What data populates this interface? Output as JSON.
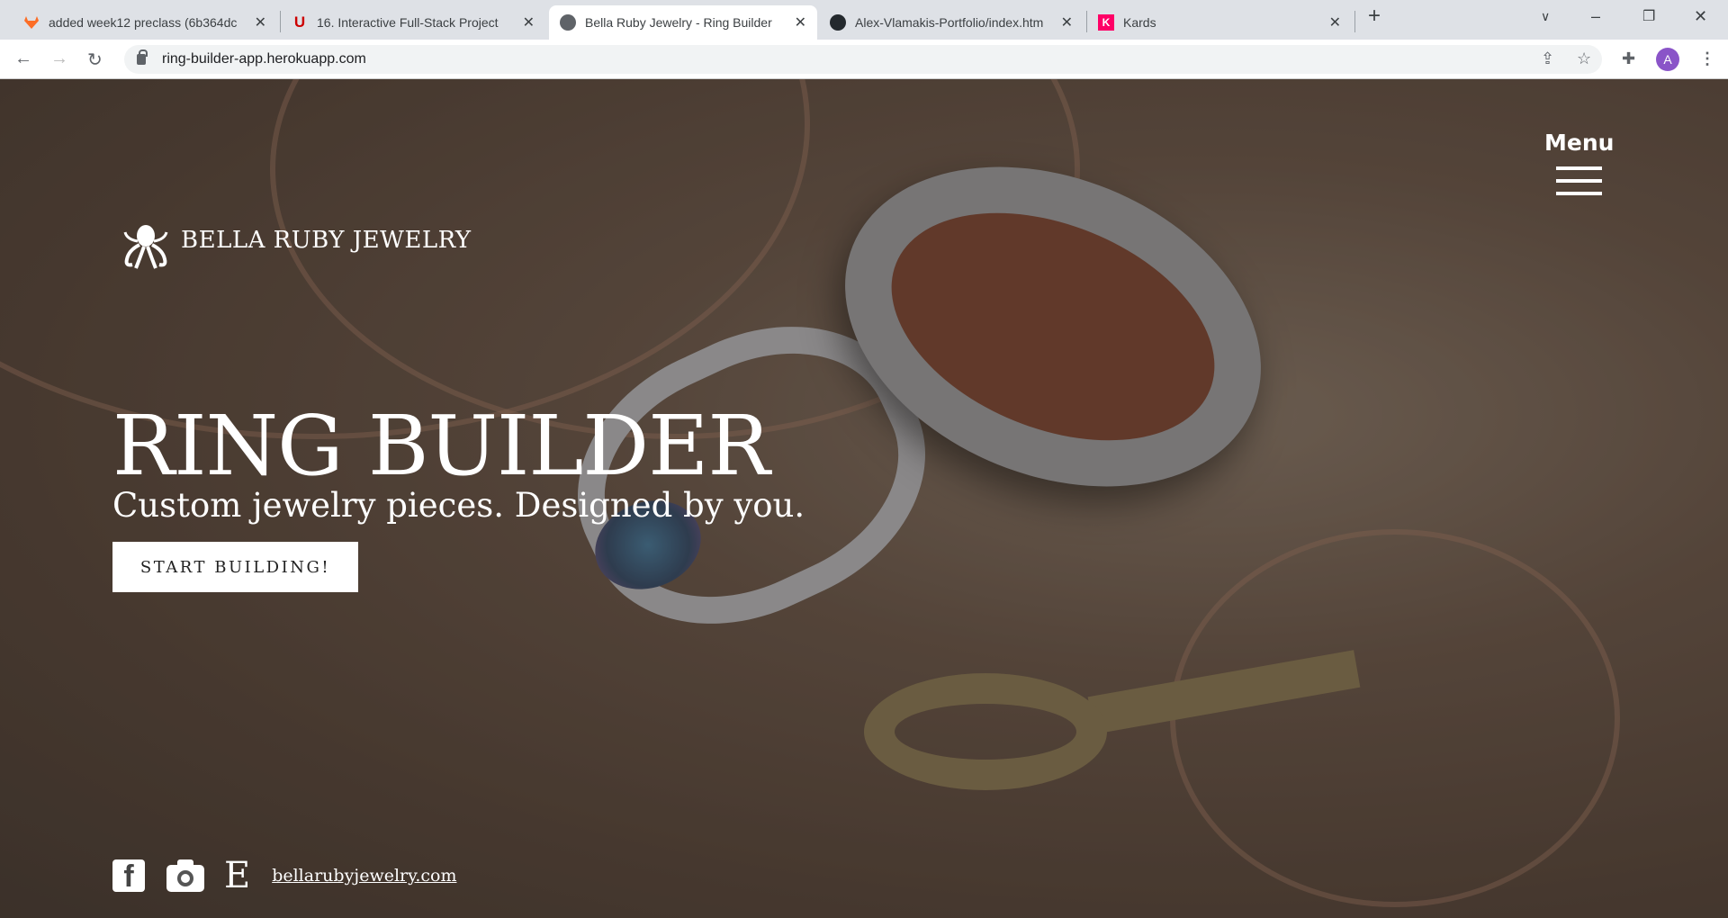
{
  "browser": {
    "tabs": [
      {
        "title": "added week12 preclass (6b364dc",
        "icon": "gitlab-icon",
        "color": "#fc6d26"
      },
      {
        "title": "16. Interactive Full-Stack Project",
        "icon": "utah-u-icon",
        "color": "#cc0000"
      },
      {
        "title": "Bella Ruby Jewelry - Ring Builder",
        "icon": "globe-icon",
        "active": true
      },
      {
        "title": "Alex-Vlamakis-Portfolio/index.htm",
        "icon": "github-icon"
      },
      {
        "title": "Kards",
        "icon": "kards-icon",
        "color": "#ff0066",
        "glyph": "K"
      }
    ],
    "url": "ring-builder-app.herokuapp.com",
    "profile_initial": "A",
    "profile_color": "#8a54c8"
  },
  "site": {
    "brand": "BELLA RUBY JEWELRY",
    "menu_label": "Menu",
    "hero_title": "RING BUILDER",
    "hero_subtitle": "Custom jewelry pieces. Designed by you.",
    "cta_label": "START BUILDING!",
    "etsy_glyph": "E",
    "facebook_glyph": "f",
    "website_link": "bellarubyjewelry.com"
  }
}
